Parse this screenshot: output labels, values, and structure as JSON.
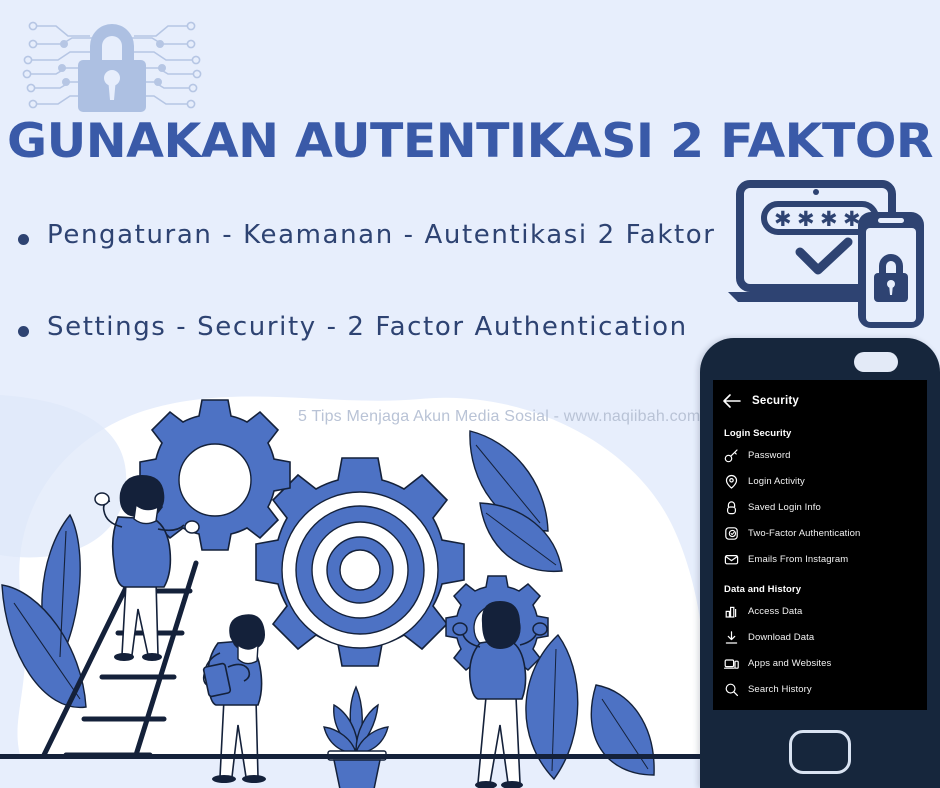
{
  "poster": {
    "background_color": "#e7eefc",
    "title": "GUNAKAN AUTENTIKASI 2 FAKTOR",
    "title_color": "#3a5aa8",
    "body_color": "#2e4372",
    "accent_blue": "#4d72c4",
    "lock_badge_icon": "padlock-circuit-icon"
  },
  "bullets": [
    {
      "text": "Pengaturan - Keamanan - Autentikasi 2 Faktor"
    },
    {
      "text": "Settings - Security - 2 Factor Authentication"
    }
  ],
  "watermark": {
    "text": "5 Tips Menjaga Akun Media Sosial - www.naqiibah.com",
    "color": "#b9c3d6"
  },
  "devices_art": {
    "laptop_icon": "laptop-icon",
    "password_mask": "✱ ✱ ✱ ✱",
    "check_icon": "checkmark-icon",
    "phone_icon": "smartphone-icon",
    "phone_lock_icon": "padlock-icon"
  },
  "illustration": {
    "gear_large_icon": "gear-icon",
    "gear_medium_icon": "gear-icon",
    "gear_small_icon": "gear-icon",
    "ladder_icon": "ladder-icon",
    "plant_pot_icon": "potted-plant-icon",
    "leaf_icon": "leaf-icon",
    "person_on_ladder": "person-icon",
    "person_with_tablet": "person-icon",
    "person_holding_gear": "person-icon"
  },
  "phone": {
    "speaker": "speaker-pill",
    "home_button": "home-button",
    "screen": {
      "back_icon": "back-arrow-icon",
      "title": "Security",
      "sections": [
        {
          "label": "Login Security",
          "items": [
            {
              "label": "Password",
              "icon": "key-icon"
            },
            {
              "label": "Login Activity",
              "icon": "location-pin-icon"
            },
            {
              "label": "Saved Login Info",
              "icon": "padlock-icon"
            },
            {
              "label": "Two-Factor Authentication",
              "icon": "shield-check-icon"
            },
            {
              "label": "Emails From Instagram",
              "icon": "envelope-icon"
            }
          ]
        },
        {
          "label": "Data and History",
          "items": [
            {
              "label": "Access Data",
              "icon": "bar-chart-icon"
            },
            {
              "label": "Download Data",
              "icon": "download-icon"
            },
            {
              "label": "Apps and Websites",
              "icon": "devices-icon"
            },
            {
              "label": "Search History",
              "icon": "search-icon"
            }
          ]
        }
      ]
    }
  }
}
